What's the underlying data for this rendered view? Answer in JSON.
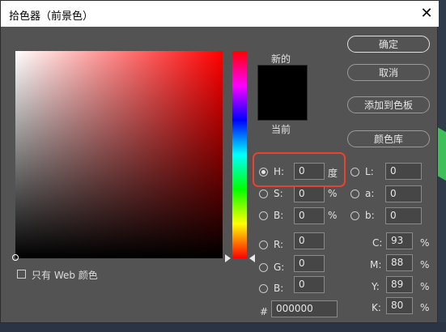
{
  "window": {
    "title": "拾色器（前景色）"
  },
  "only_web_label": "只有 Web 颜色",
  "new_label": "新的",
  "current_label": "当前",
  "buttons": {
    "ok": "确定",
    "cancel": "取消",
    "add_swatch": "添加到色板",
    "color_library": "颜色库"
  },
  "hsb": [
    {
      "label": "H:",
      "value": "0",
      "unit": "度"
    },
    {
      "label": "S:",
      "value": "0",
      "unit": "%"
    },
    {
      "label": "B:",
      "value": "0",
      "unit": "%"
    }
  ],
  "lab": [
    {
      "label": "L:",
      "value": "0"
    },
    {
      "label": "a:",
      "value": "0"
    },
    {
      "label": "b:",
      "value": "0"
    }
  ],
  "rgb": [
    {
      "label": "R:",
      "value": "0"
    },
    {
      "label": "G:",
      "value": "0"
    },
    {
      "label": "B:",
      "value": "0"
    }
  ],
  "cmyk": [
    {
      "label": "C:",
      "value": "93",
      "unit": "%"
    },
    {
      "label": "M:",
      "value": "88",
      "unit": "%"
    },
    {
      "label": "Y:",
      "value": "89",
      "unit": "%"
    },
    {
      "label": "K:",
      "value": "80",
      "unit": "%"
    }
  ],
  "hex": {
    "label": "#",
    "value": "000000"
  },
  "colors": {
    "new": "#000000",
    "current": "#000000",
    "highlight": "#e8432e"
  },
  "icons": {
    "close": "close-icon"
  }
}
